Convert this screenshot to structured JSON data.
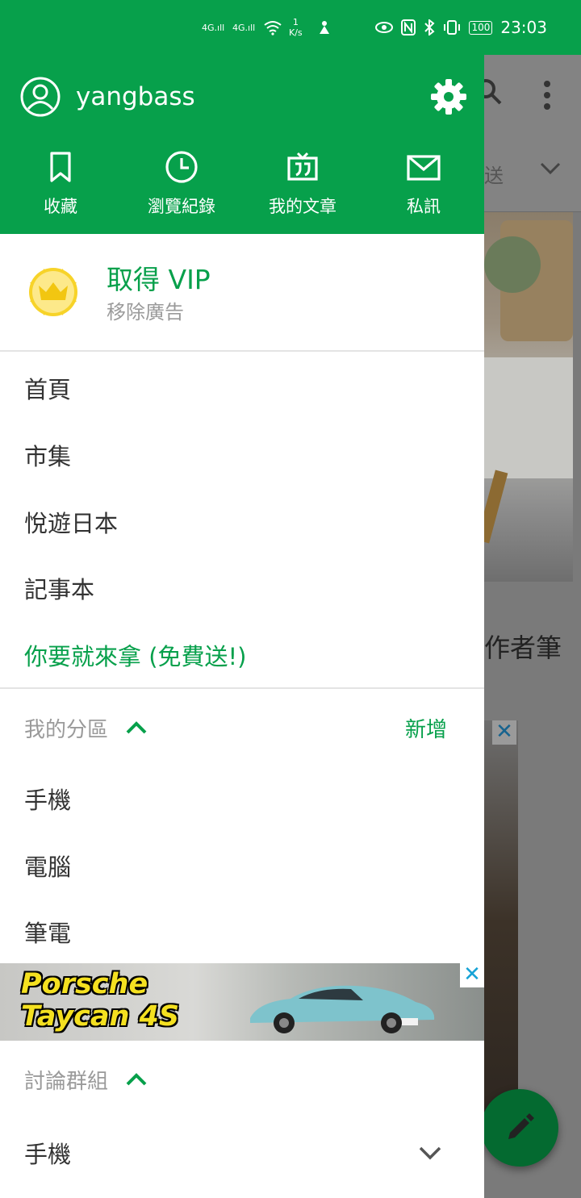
{
  "status_bar": {
    "signal1": "4G",
    "signal2": "4G",
    "speed_value": "1",
    "speed_unit": "K/s",
    "battery": "100",
    "time": "23:03"
  },
  "background_app": {
    "tab_text": "送",
    "article_caption": "作者筆"
  },
  "drawer": {
    "username": "yangbass",
    "quick_actions": [
      {
        "label": "收藏",
        "icon": "bookmark-icon"
      },
      {
        "label": "瀏覽紀錄",
        "icon": "clock-icon"
      },
      {
        "label": "我的文章",
        "icon": "quote-icon"
      },
      {
        "label": "私訊",
        "icon": "mail-icon"
      }
    ],
    "vip": {
      "title": "取得 VIP",
      "subtitle": "移除廣告"
    },
    "menu": [
      {
        "label": "首頁"
      },
      {
        "label": "市集"
      },
      {
        "label": "悅遊日本"
      },
      {
        "label": "記事本"
      },
      {
        "label": "你要就來拿 (免費送!)"
      }
    ],
    "my_boards": {
      "title": "我的分區",
      "add_label": "新增",
      "items": [
        {
          "label": "手機"
        },
        {
          "label": "電腦"
        },
        {
          "label": "筆電"
        }
      ]
    },
    "ad": {
      "text_line1": "Porsche",
      "text_line2": "Taycan 4S",
      "close": "✕"
    },
    "groups": {
      "title": "討論群組",
      "items": [
        {
          "label": "手機"
        }
      ]
    }
  },
  "colors": {
    "brand_green": "#07a04b",
    "fab_green": "#046a30"
  }
}
